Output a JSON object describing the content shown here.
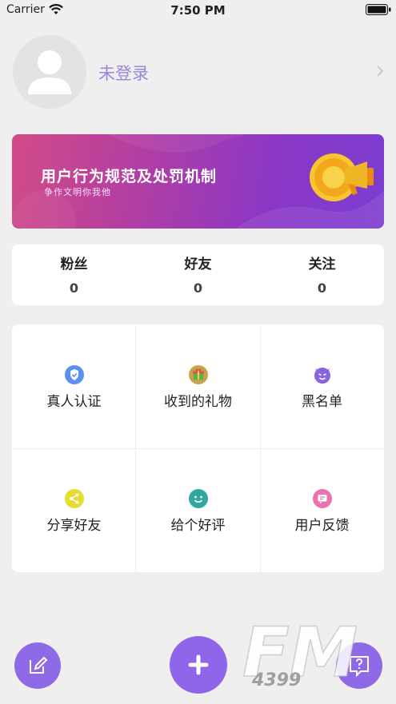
{
  "status_bar": {
    "carrier": "Carrier",
    "time": "7:50 PM"
  },
  "profile": {
    "login_label": "未登录"
  },
  "banner": {
    "title": "用户行为规范及处罚机制",
    "subtitle": "争作文明你我他"
  },
  "stats": [
    {
      "label": "粉丝",
      "value": "0"
    },
    {
      "label": "好友",
      "value": "0"
    },
    {
      "label": "关注",
      "value": "0"
    }
  ],
  "menu": [
    {
      "label": "真人认证",
      "icon": "shield-check-icon",
      "color": "#5b8ff0"
    },
    {
      "label": "收到的礼物",
      "icon": "gift-icon",
      "color": "#c4a44a"
    },
    {
      "label": "黑名单",
      "icon": "devil-icon",
      "color": "#8a63df"
    },
    {
      "label": "分享好友",
      "icon": "share-icon",
      "color": "#e6dc2e"
    },
    {
      "label": "给个好评",
      "icon": "smile-icon",
      "color": "#2fa89b"
    },
    {
      "label": "用户反馈",
      "icon": "feedback-icon",
      "color": "#e873b0"
    }
  ],
  "colors": {
    "accent": "#8d66ea",
    "login_text": "#9b86d8",
    "background": "#efefef"
  },
  "watermark": {
    "brand": "FM",
    "number": "4399"
  }
}
